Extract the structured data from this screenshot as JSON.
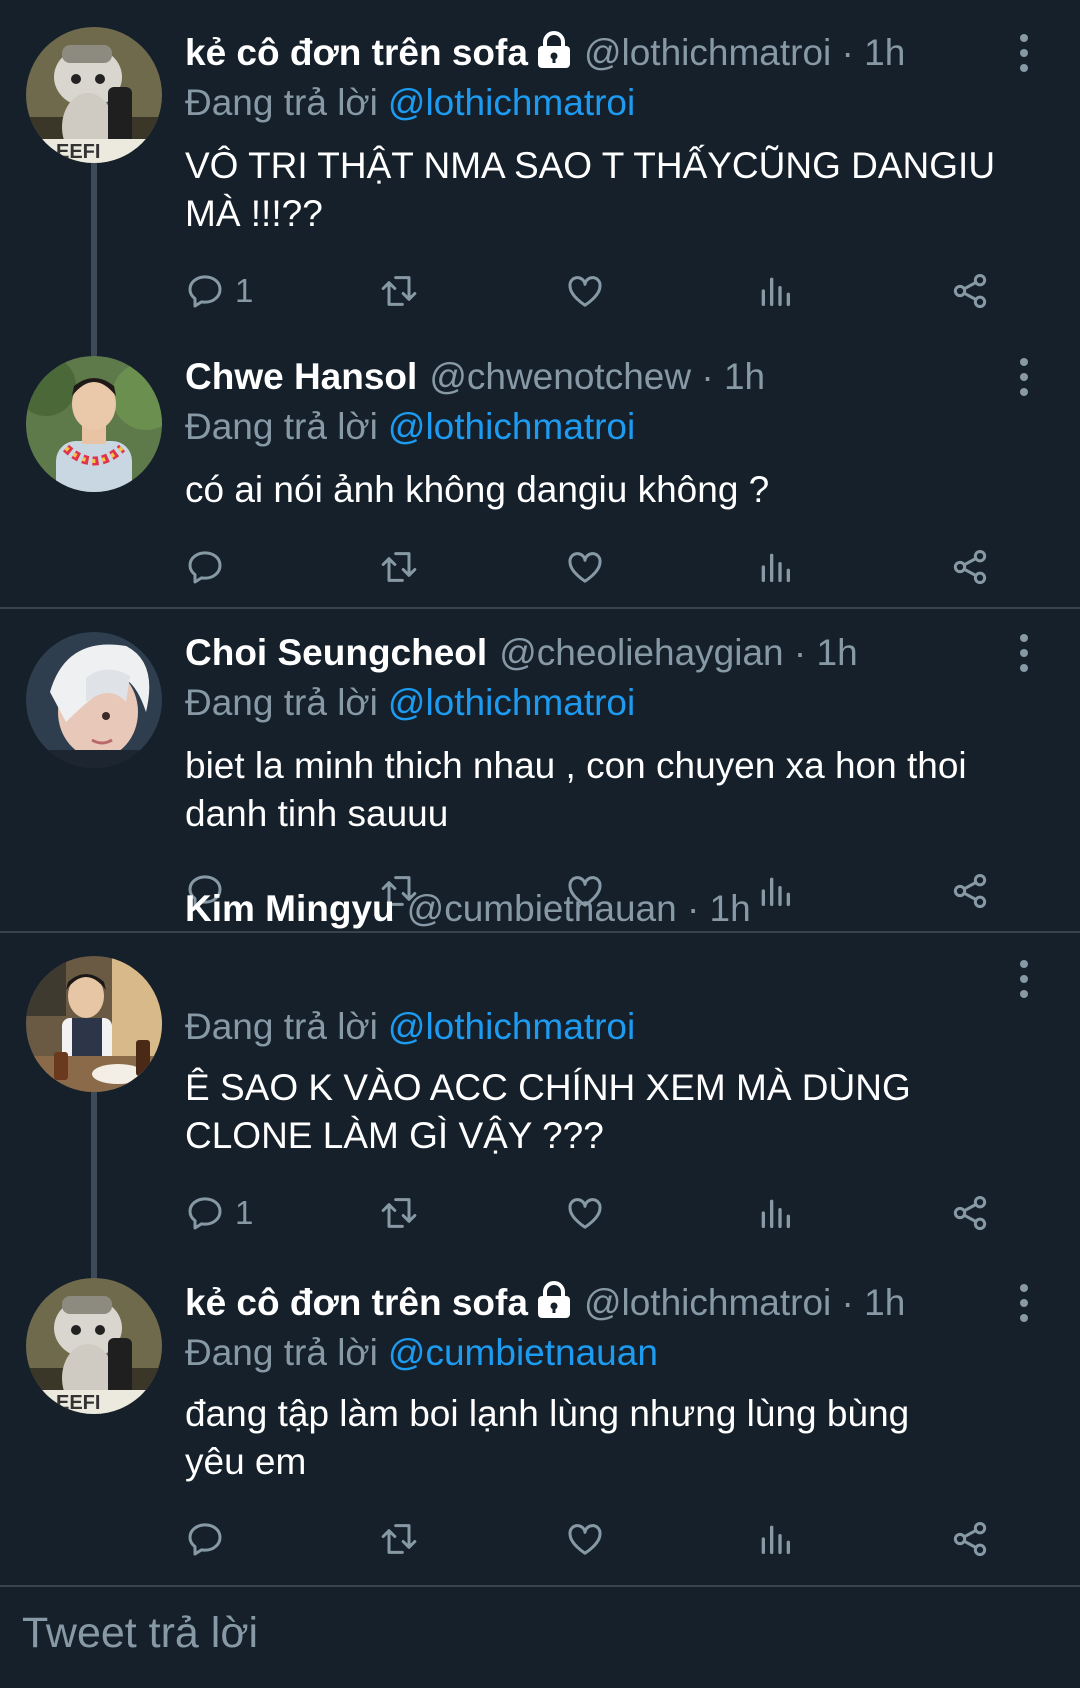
{
  "reply_prefix": "Đang trả lời",
  "tweets": [
    {
      "name": "kẻ cô đơn trên sofa",
      "locked": true,
      "handle": "@lothichmatroi · 1h",
      "reply_to": "@lothichmatroi",
      "text": "VÔ TRI THẬT NMA SAO T THẤYCŨNG DANGIU\nMÀ !!!??",
      "reply_count": "1",
      "avatar": "cat-avatar"
    },
    {
      "name": "Chwe Hansol",
      "locked": false,
      "handle": "@chwenotchew · 1h",
      "reply_to": "@lothichmatroi",
      "text": "có ai nói ảnh không dangiu không ?",
      "reply_count": "",
      "avatar": "person-lei-avatar"
    },
    {
      "name": "Choi Seungcheol",
      "locked": false,
      "handle": "@cheoliehaygian · 1h",
      "reply_to": "@lothichmatroi",
      "text": "biet la minh thich nhau , con chuyen xa hon thoi\ndanh tinh sauuu",
      "reply_count": "",
      "avatar": "blond-person-avatar"
    },
    {
      "name": "Kim Mingyu",
      "locked": false,
      "handle": "@cumbietnauan · 1h",
      "reply_to": "@lothichmatroi",
      "text": "Ê SAO K VÀO ACC CHÍNH XEM MÀ DÙNG\nCLONE LÀM GÌ VẬY ???",
      "reply_count": "1",
      "avatar": "cafe-person-avatar"
    },
    {
      "name": "kẻ cô đơn trên sofa",
      "locked": true,
      "handle": "@lothichmatroi · 1h",
      "reply_to": "@cumbietnauan",
      "text": "đang tập làm boi lạnh lùng nhưng lùng bùng\nyêu em",
      "reply_count": "",
      "avatar": "cat-avatar"
    }
  ],
  "compose": {
    "placeholder": "Tweet trả lời"
  },
  "colors": {
    "background": "#15202b",
    "accent": "#1d9bf0",
    "muted": "#8899a6",
    "divider": "#38444d"
  }
}
